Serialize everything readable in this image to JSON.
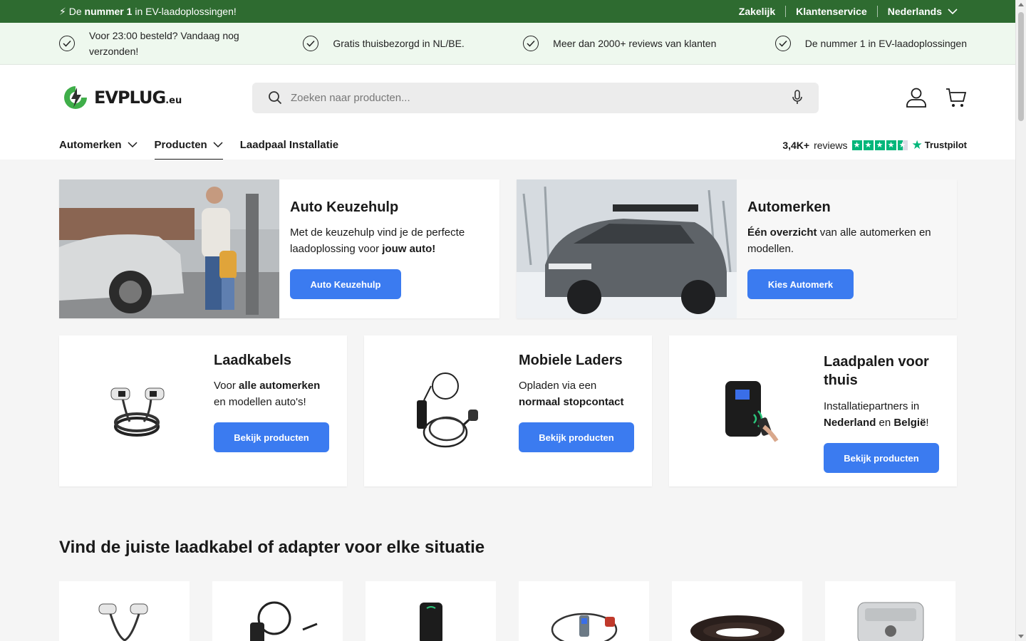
{
  "announcement": {
    "prefix": "⚡ De ",
    "bold": "nummer 1",
    "suffix": " in EV-laadoplossingen!",
    "links": {
      "business": "Zakelijk",
      "service": "Klantenservice",
      "language": "Nederlands"
    }
  },
  "usps": [
    {
      "text": "Voor 23:00 besteld? Vandaag nog verzonden!"
    },
    {
      "text": "Gratis thuisbezorgd in NL/BE."
    },
    {
      "text": "Meer dan 2000+ reviews van klanten"
    },
    {
      "text": "De nummer 1 in EV-laadoplossingen"
    }
  ],
  "header": {
    "logo_word": "EVPLUG",
    "logo_tld": ".eu",
    "search_placeholder": "Zoeken naar producten..."
  },
  "nav": {
    "items": [
      {
        "label": "Automerken"
      },
      {
        "label": "Producten"
      },
      {
        "label": "Laadpaal Installatie"
      }
    ],
    "reviews_count": "3,4K+",
    "reviews_label": "reviews",
    "trustpilot": "Trustpilot",
    "rating_stars": 4.5
  },
  "big_cards": [
    {
      "title": "Auto Keuzehulp",
      "text_before": "Met de keuzehulp vind je de perfecte laadoplossing voor ",
      "text_bold": "jouw auto!",
      "text_after": "",
      "button": "Auto Keuzehulp"
    },
    {
      "title": "Automerken",
      "text_before": "",
      "text_bold": "Één overzicht",
      "text_after": " van alle automerken en modellen.",
      "button": "Kies Automerk"
    }
  ],
  "small_cards": [
    {
      "title": "Laadkabels",
      "text_before": "Voor ",
      "text_bold": "alle automerken",
      "text_after": " en modellen auto's!",
      "button": "Bekijk producten"
    },
    {
      "title": "Mobiele Laders",
      "text_before": "Opladen via een ",
      "text_bold": "normaal stopcontact",
      "text_after": "",
      "button": "Bekijk producten"
    },
    {
      "title": "Laadpalen voor thuis",
      "text_before": "Installatiepartners in ",
      "text_bold": "Nederland",
      "text_middle": " en ",
      "text_bold2": "België",
      "text_after": "!",
      "button": "Bekijk producten"
    }
  ],
  "section_title": "Vind de juiste laadkabel of adapter voor elke situatie",
  "colors": {
    "announce_bg": "#2e6b30",
    "usp_bg": "#eef8ee",
    "button_blue": "#3b7bf0",
    "trustpilot_green": "#00b67a"
  }
}
